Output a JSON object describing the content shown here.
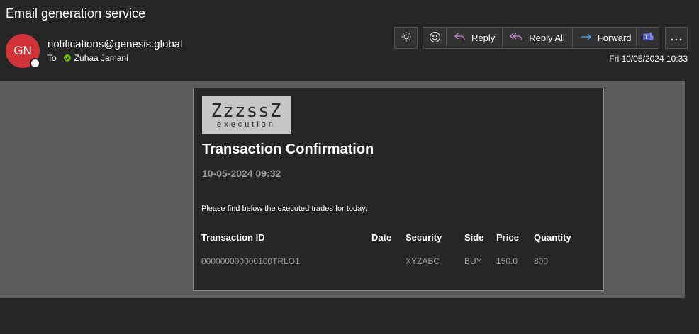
{
  "email": {
    "subject": "Email generation service",
    "avatar_initials": "GN",
    "sender": "notifications@genesis.global",
    "to_label": "To",
    "recipient": "Zuhaa Jamani",
    "date": "Fri 10/05/2024 10:33",
    "colors": {
      "avatar": "#d13438",
      "presence": "#6bb700"
    }
  },
  "toolbar": {
    "brightness_icon": "sun-icon",
    "emoji_icon": "smiley-icon",
    "reply_label": "Reply",
    "reply_all_label": "Reply All",
    "forward_label": "Forward",
    "teams_icon": "teams-icon",
    "more_icon": "ellipsis-icon"
  },
  "message": {
    "logo_main": "ZzzssZ",
    "logo_sub": "execution",
    "title": "Transaction Confirmation",
    "timestamp": "10-05-2024 09:32",
    "intro": "Please find below the executed trades for today.",
    "table": {
      "headers": [
        "Transaction ID",
        "Date",
        "Security",
        "Side",
        "Price",
        "Quantity"
      ],
      "rows": [
        [
          "000000000000100TRLO1",
          "",
          "XYZABC",
          "BUY",
          "150.0",
          "800"
        ]
      ]
    }
  }
}
